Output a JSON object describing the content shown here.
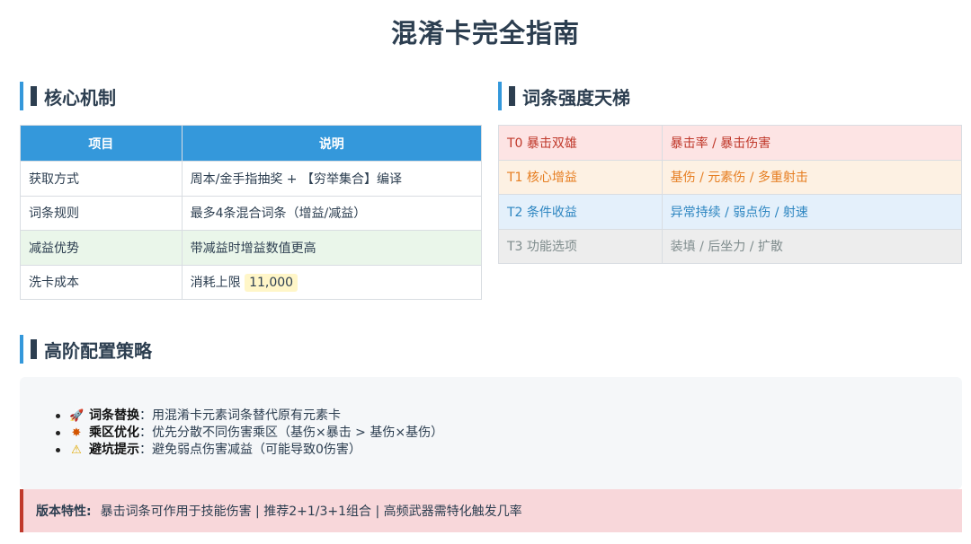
{
  "page": {
    "title": "混淆卡完全指南"
  },
  "mechanics": {
    "heading": "核心机制",
    "headers": [
      "项目",
      "说明"
    ],
    "rows": [
      {
        "item": "获取方式",
        "desc": "周本/金手指抽奖 + 【穷举集合】编译"
      },
      {
        "item": "词条规则",
        "desc": "最多4条混合词条（增益/减益）"
      },
      {
        "item": "减益优势",
        "desc": "带减益时增益数值更高"
      },
      {
        "item": "洗卡成本",
        "desc": "消耗上限",
        "value": "11,000"
      }
    ]
  },
  "tiers": {
    "heading": "词条强度天梯",
    "rows": [
      {
        "tier": "T0 暴击双雄",
        "stats": "暴击率 / 暴击伤害",
        "color": "#c0392b",
        "bg": "#fde4e4"
      },
      {
        "tier": "T1 核心增益",
        "stats": "基伤 / 元素伤 / 多重射击",
        "color": "#e67e22",
        "bg": "#fdf1e3"
      },
      {
        "tier": "T2 条件收益",
        "stats": "异常持续 / 弱点伤 / 射速",
        "color": "#2e86c1",
        "bg": "#e4f0fb"
      },
      {
        "tier": "T3 功能选项",
        "stats": "装填 / 后坐力 / 扩散",
        "color": "#7f8c8d",
        "bg": "#ededed"
      }
    ]
  },
  "strategy": {
    "heading": "高阶配置策略",
    "items": [
      {
        "icon": "rocket-icon",
        "glyph": "🚀",
        "title": "词条替换",
        "text": "：用混淆卡元素词条替代原有元素卡"
      },
      {
        "icon": "collision-icon",
        "glyph": "✸",
        "title": "乘区优化",
        "text": "：优先分散不同伤害乘区（基伤×暴击 > 基伤×基伤）"
      },
      {
        "icon": "warning-icon",
        "glyph": "⚠",
        "title": "避坑提示",
        "text": "：避免弱点伤害减益（可能导致0伤害）"
      }
    ]
  },
  "version": {
    "label": "版本特性:",
    "text": "暴击词条可作用于技能伤害 | 推荐2+1/3+1组合 | 高频武器需特化触发几率"
  }
}
